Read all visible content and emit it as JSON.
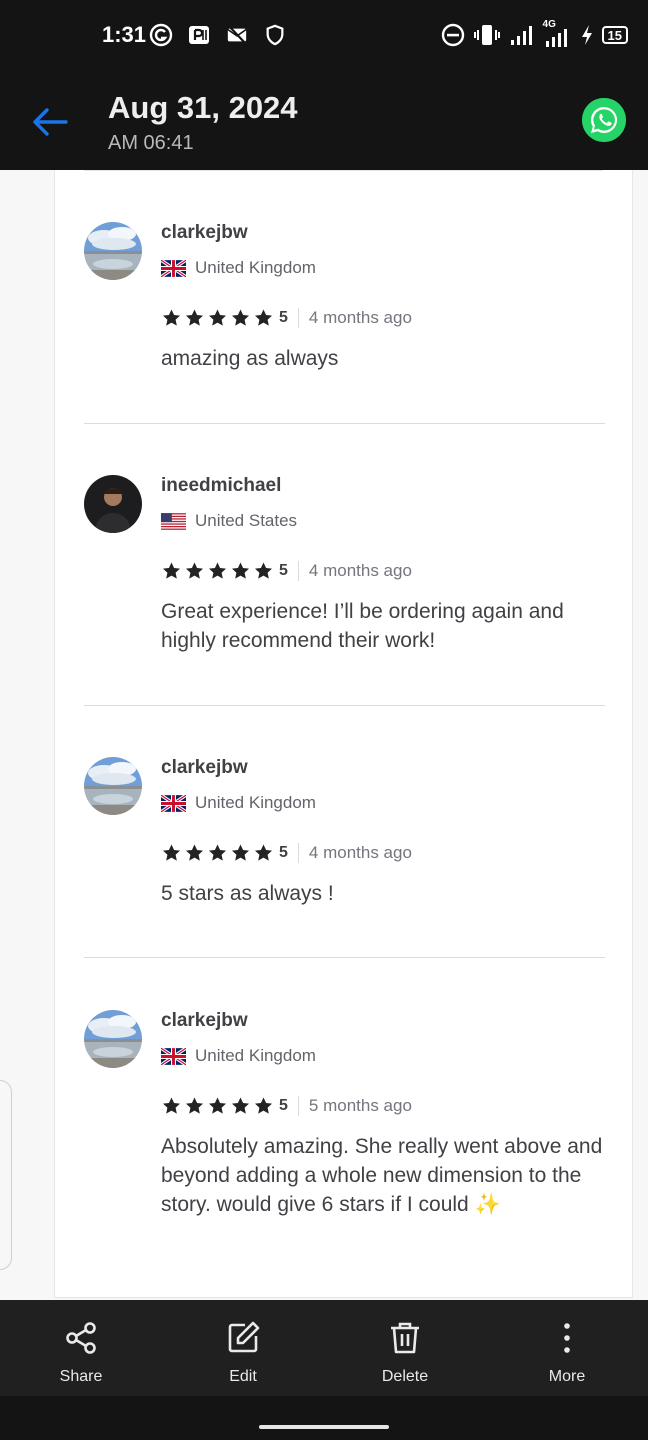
{
  "status_bar": {
    "time": "1:31",
    "network": "4G",
    "battery": "15"
  },
  "header": {
    "title": "Aug 31, 2024",
    "subtitle": "AM 06:41"
  },
  "reviews": [
    {
      "name": "clarkejbw",
      "country": "United Kingdom",
      "flag": "uk-flag",
      "rating": "5",
      "ago": "4 months ago",
      "text": "amazing as always"
    },
    {
      "name": "ineedmichael",
      "country": "United States",
      "flag": "us-flag",
      "rating": "5",
      "ago": "4 months ago",
      "text": "Great experience! I’ll be ordering again and highly recommend their work!"
    },
    {
      "name": "clarkejbw",
      "country": "United Kingdom",
      "flag": "uk-flag",
      "rating": "5",
      "ago": "4 months ago",
      "text": "5 stars as always !"
    },
    {
      "name": "clarkejbw",
      "country": "United Kingdom",
      "flag": "uk-flag",
      "rating": "5",
      "ago": "5 months ago",
      "text": "Absolutely amazing. She really went above and beyond adding a whole new dimension to the story. would give 6 stars if I could ✨"
    }
  ],
  "actions": {
    "share": "Share",
    "edit": "Edit",
    "delete": "Delete",
    "more": "More"
  },
  "colors": {
    "accent_blue": "#1a73e8",
    "whatsapp_green": "#25d366",
    "star": "#222325"
  }
}
